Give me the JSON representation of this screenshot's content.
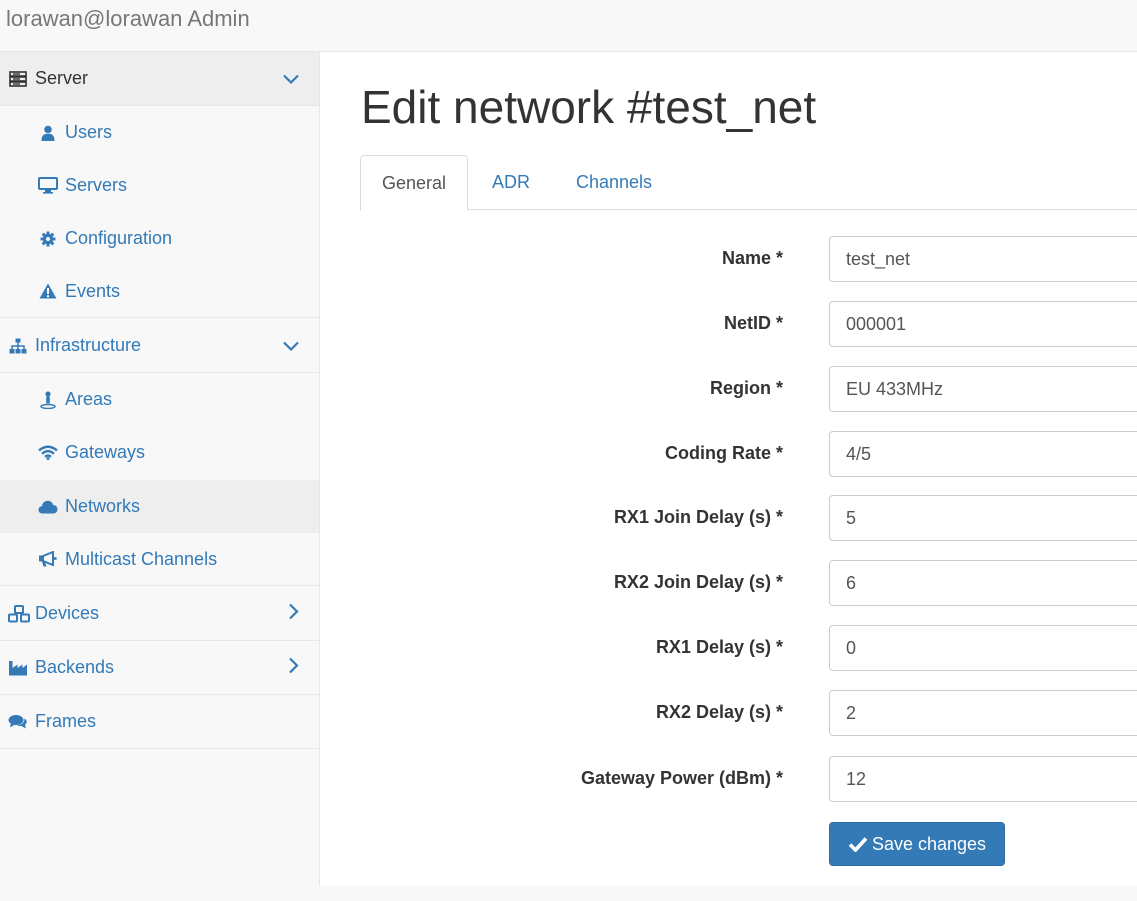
{
  "app": {
    "title": "lorawan@lorawan Admin"
  },
  "sidebar": {
    "server": {
      "label": "Server",
      "icon": "server-icon",
      "items": [
        {
          "label": "Users",
          "icon": "user-icon"
        },
        {
          "label": "Servers",
          "icon": "monitor-icon"
        },
        {
          "label": "Configuration",
          "icon": "gear-icon"
        },
        {
          "label": "Events",
          "icon": "warning-icon"
        }
      ]
    },
    "infrastructure": {
      "label": "Infrastructure",
      "icon": "sitemap-icon",
      "items": [
        {
          "label": "Areas",
          "icon": "map-pin-icon"
        },
        {
          "label": "Gateways",
          "icon": "wifi-icon"
        },
        {
          "label": "Networks",
          "icon": "cloud-icon",
          "active": true
        },
        {
          "label": "Multicast Channels",
          "icon": "bullhorn-icon"
        }
      ]
    },
    "devices": {
      "label": "Devices",
      "icon": "cubes-icon"
    },
    "backends": {
      "label": "Backends",
      "icon": "industry-icon"
    },
    "frames": {
      "label": "Frames",
      "icon": "comments-icon"
    }
  },
  "page": {
    "title": "Edit network #test_net",
    "tabs": [
      {
        "label": "General",
        "active": true
      },
      {
        "label": "ADR"
      },
      {
        "label": "Channels"
      }
    ]
  },
  "form": {
    "fields": [
      {
        "label": "Name *",
        "value": "test_net"
      },
      {
        "label": "NetID *",
        "value": "000001"
      },
      {
        "label": "Region *",
        "value": "EU 433MHz"
      },
      {
        "label": "Coding Rate *",
        "value": "4/5"
      },
      {
        "label": "RX1 Join Delay (s) *",
        "value": "5"
      },
      {
        "label": "RX2 Join Delay (s) *",
        "value": "6"
      },
      {
        "label": "RX1 Delay (s) *",
        "value": "0"
      },
      {
        "label": "RX2 Delay (s) *",
        "value": "2"
      },
      {
        "label": "Gateway Power (dBm) *",
        "value": "12"
      }
    ],
    "save_label": "Save changes"
  },
  "colors": {
    "link": "#337ab7",
    "primary_button": "#337ab7",
    "active_bg": "#eeeeee"
  }
}
